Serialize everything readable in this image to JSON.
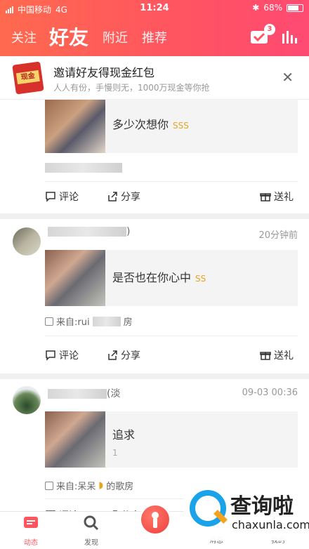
{
  "status_bar": {
    "carrier": "中国移动",
    "network": "4G",
    "time": "11:24",
    "battery": "68%"
  },
  "header": {
    "tabs": [
      {
        "label": "关注"
      },
      {
        "label": "好友"
      },
      {
        "label": "附近"
      },
      {
        "label": "推荐"
      }
    ],
    "active_tab": "好友",
    "notification_badge": "3"
  },
  "invite_banner": {
    "envelope_label": "现金",
    "title": "邀请好友得现金红包",
    "subtitle": "人人有份，手慢则无，1000万现金等你抢"
  },
  "feed": [
    {
      "share_text": "多少次想你",
      "tag": "SSS",
      "source": "",
      "actions": {
        "comment": "评论",
        "share": "分享",
        "gift": "送礼"
      }
    },
    {
      "username_suffix": ")",
      "time": "20分钟前",
      "share_text": "是否也在你心中",
      "tag": "SS",
      "source": "来自:rui",
      "source_suffix": "房",
      "actions": {
        "comment": "评论",
        "share": "分享",
        "gift": "送礼"
      }
    },
    {
      "username_suffix": "(淡",
      "time": "09-03 00:36",
      "share_text": "追求",
      "count": "1",
      "source": "来自:呆呆",
      "source_suffix": "的歌房",
      "actions": {
        "comment": "评论",
        "share": "分享"
      }
    }
  ],
  "bottom_nav": [
    {
      "label": "动态"
    },
    {
      "label": "发现"
    },
    {
      "label": "消息"
    },
    {
      "label": "我的"
    }
  ],
  "watermark": {
    "cn": "查询啦",
    "en": "chaxunla.com"
  },
  "colors": {
    "accent": "#ff5560",
    "gold": "#e4a520"
  }
}
